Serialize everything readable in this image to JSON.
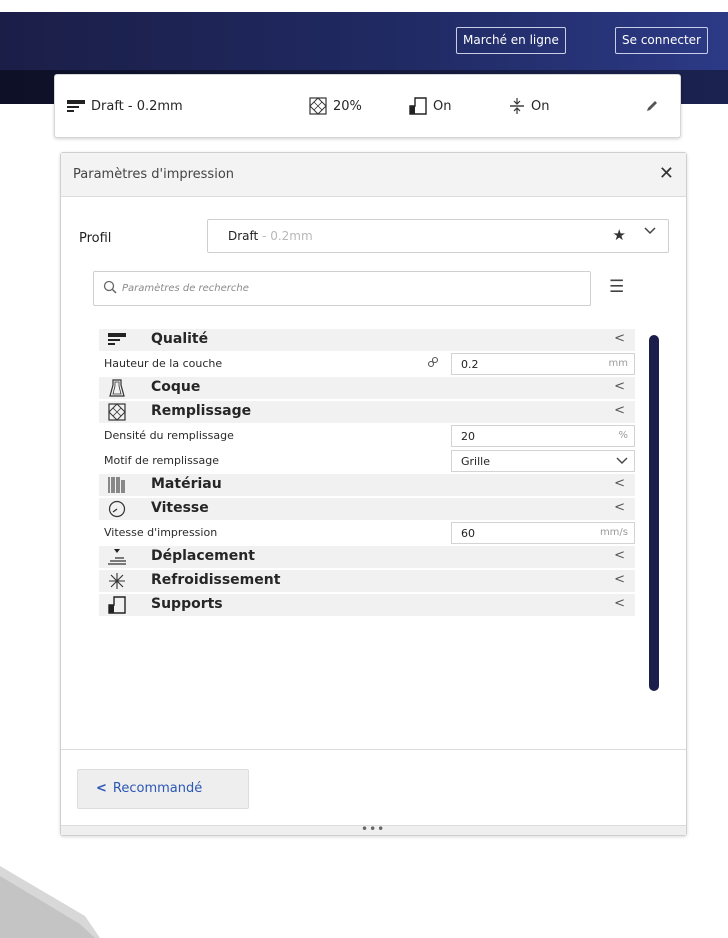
{
  "topbar": {
    "marketplace_label": "Marché en ligne",
    "signin_label": "Se connecter"
  },
  "settings_bar": {
    "profile": "Draft - 0.2mm",
    "infill": "20%",
    "support": "On",
    "adhesion": "On"
  },
  "panel": {
    "title": "Paramètres d'impression",
    "profil_label": "Profil",
    "profil_name": "Draft",
    "profil_suffix": " - 0.2mm",
    "search_placeholder": "Paramètres de recherche",
    "categories": {
      "qualite": "Qualité",
      "coque": "Coque",
      "remplissage": "Remplissage",
      "materiau": "Matériau",
      "vitesse": "Vitesse",
      "deplacement": "Déplacement",
      "refroidissement": "Refroidissement",
      "supports": "Supports"
    },
    "settings": {
      "layer_height": {
        "label": "Hauteur de la couche",
        "value": "0.2",
        "unit": "mm"
      },
      "infill_density": {
        "label": "Densité du remplissage",
        "value": "20",
        "unit": "%"
      },
      "infill_pattern": {
        "label": "Motif de remplissage",
        "value": "Grille"
      },
      "print_speed": {
        "label": "Vitesse d'impression",
        "value": "60",
        "unit": "mm/s"
      }
    },
    "recommended_label": "Recommandé"
  },
  "colors": {
    "header_navy": "#1b1e47",
    "scrollbar": "#1b1e4a",
    "link_blue": "#2b57b5"
  }
}
